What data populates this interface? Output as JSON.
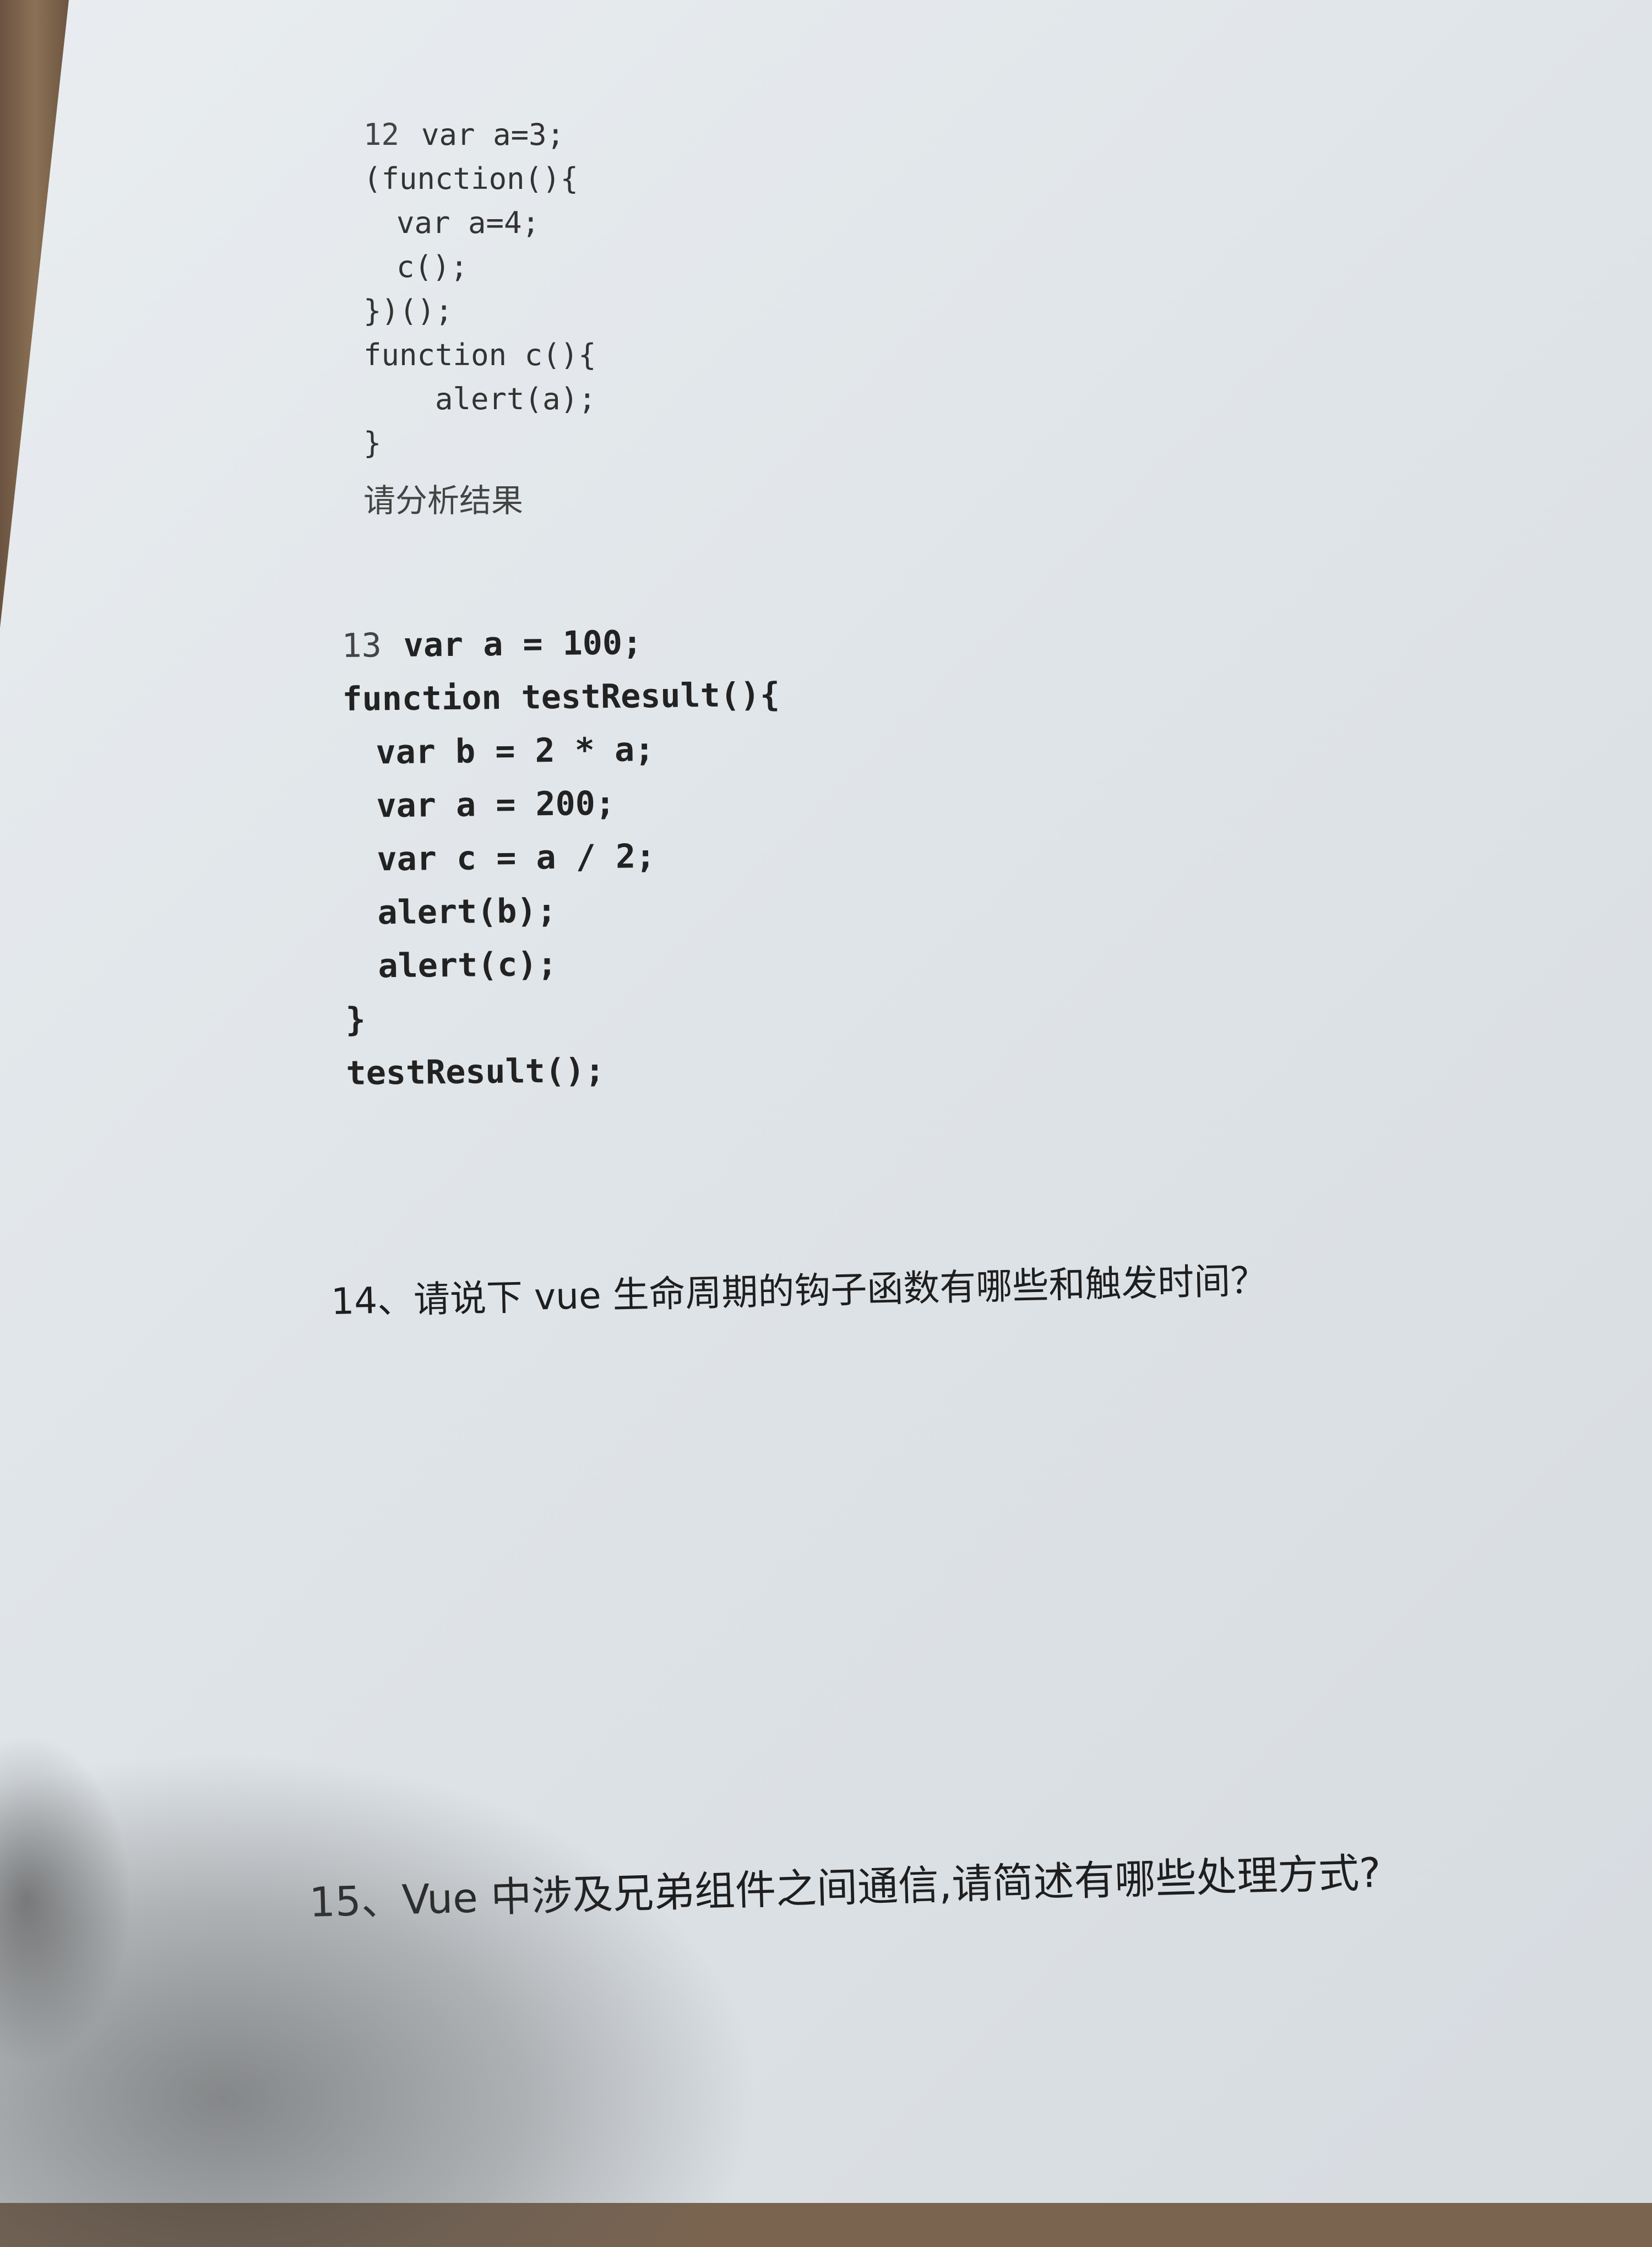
{
  "question12": {
    "number": "12",
    "first_line": "var a=3;",
    "lines": [
      "(function(){",
      "var a=4;",
      "c();",
      "})();",
      "function c(){",
      "alert(a);",
      "}"
    ],
    "prompt": "请分析结果"
  },
  "question13": {
    "number": "13",
    "first_line": "var a = 100;",
    "lines": [
      "function testResult(){",
      "var b = 2 * a;",
      "var a = 200;",
      "var c = a / 2;",
      "alert(b);",
      "alert(c);",
      "}",
      "testResult();"
    ]
  },
  "question14": {
    "text": "14、请说下 vue 生命周期的钩子函数有哪些和触发时间？"
  },
  "question15": {
    "text": "15、Vue 中涉及兄弟组件之间通信,请简述有哪些处理方式?"
  }
}
